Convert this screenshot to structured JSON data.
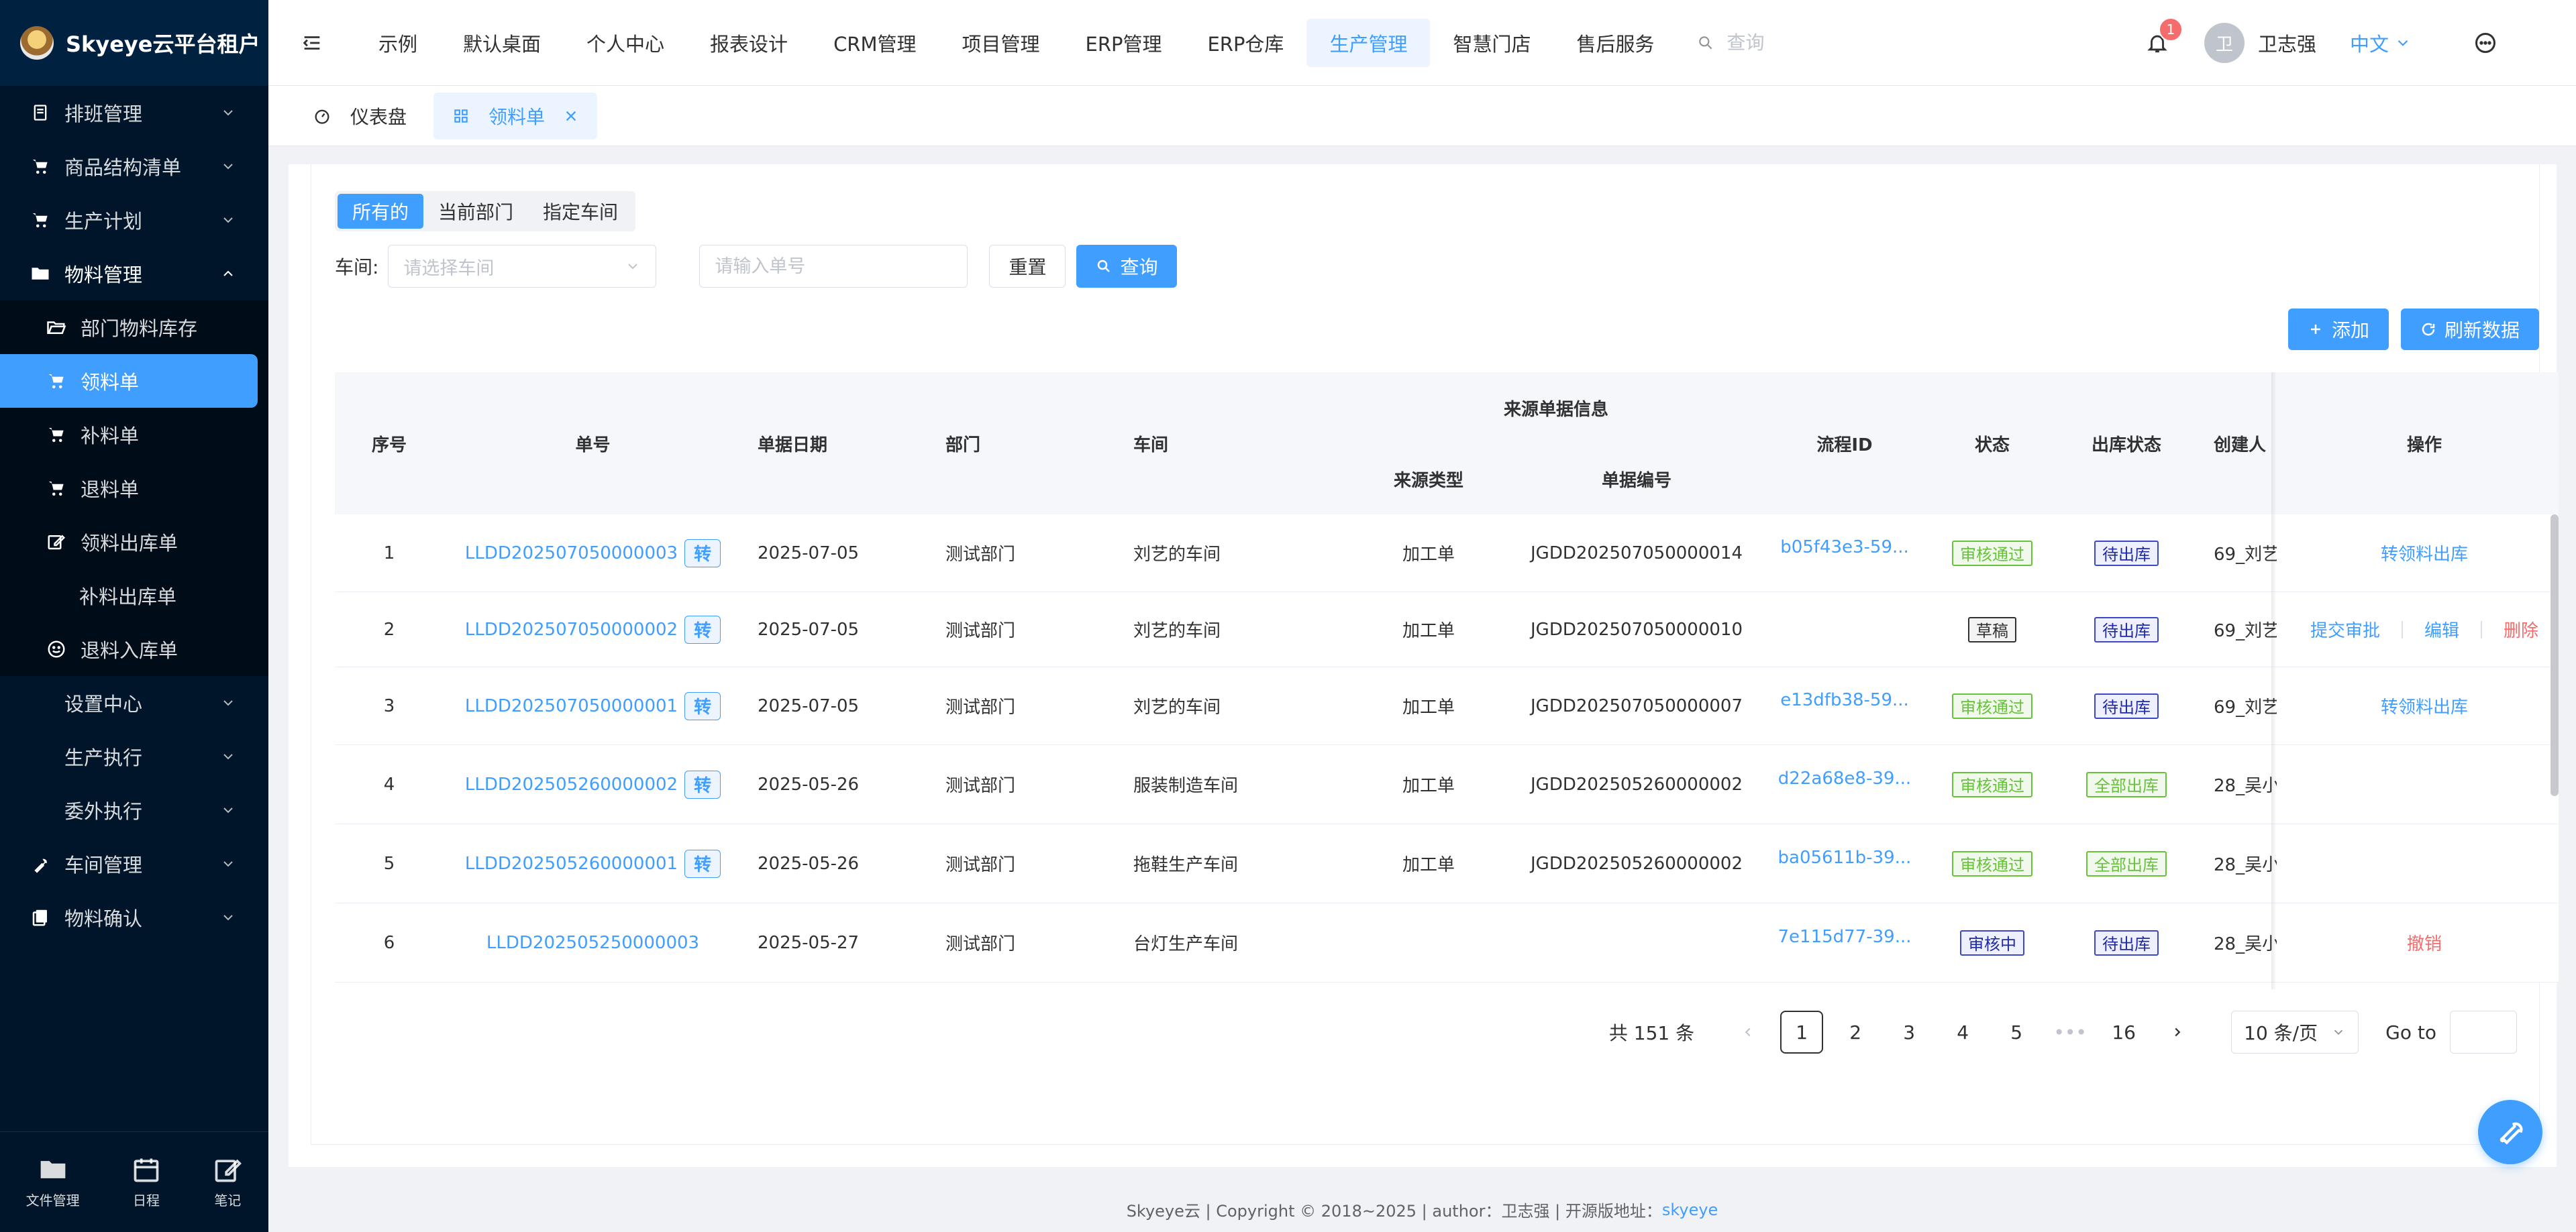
{
  "brand": {
    "title": "Skyeye云平台租户"
  },
  "sidebar": {
    "items": [
      {
        "label": "排班管理",
        "icon": "schedule-icon"
      },
      {
        "label": "商品结构清单",
        "icon": "cart-icon"
      },
      {
        "label": "生产计划",
        "icon": "cart-icon"
      },
      {
        "label": "物料管理",
        "icon": "folder-icon"
      }
    ],
    "material_sub": [
      {
        "label": "部门物料库存",
        "icon": "folder-open-icon"
      },
      {
        "label": "领料单",
        "icon": "cart-icon"
      },
      {
        "label": "补料单",
        "icon": "cart-icon"
      },
      {
        "label": "退料单",
        "icon": "cart-icon"
      },
      {
        "label": "领料出库单",
        "icon": "edit-icon"
      },
      {
        "label": "补料出库单"
      },
      {
        "label": "退料入库单",
        "icon": "smile-icon"
      }
    ],
    "groups": [
      {
        "label": "设置中心"
      },
      {
        "label": "生产执行"
      },
      {
        "label": "委外执行"
      }
    ],
    "bottom_items": [
      {
        "label": "车间管理",
        "icon": "wrench-icon"
      },
      {
        "label": "物料确认",
        "icon": "copy-icon"
      }
    ],
    "footer": {
      "files": "文件管理",
      "calendar": "日程",
      "notes": "笔记"
    }
  },
  "header": {
    "nav": [
      "示例",
      "默认桌面",
      "个人中心",
      "报表设计",
      "CRM管理",
      "项目管理",
      "ERP管理",
      "ERP仓库",
      "生产管理",
      "智慧门店",
      "售后服务"
    ],
    "active_nav": "生产管理",
    "search_placeholder": "查询",
    "notification_count": "1",
    "avatar_text": "卫",
    "username": "卫志强",
    "language": "中文"
  },
  "tabs": [
    {
      "label": "仪表盘"
    },
    {
      "label": "领料单"
    }
  ],
  "filters": {
    "segments": [
      "所有的",
      "当前部门",
      "指定车间"
    ],
    "workshop_label": "车间:",
    "workshop_placeholder": "请选择车间",
    "order_placeholder": "请输入单号",
    "reset": "重置",
    "query": "查询",
    "add": "添加",
    "refresh": "刷新数据"
  },
  "table": {
    "headers": {
      "index": "序号",
      "order_no": "单号",
      "date": "单据日期",
      "dept": "部门",
      "workshop": "车间",
      "source_group": "来源单据信息",
      "source_type": "来源类型",
      "source_no": "单据编号",
      "flow_id": "流程ID",
      "status": "状态",
      "out_status": "出库状态",
      "creator": "创建人",
      "ops": "操作"
    },
    "zhuan_label": "转",
    "rows": [
      {
        "index": "1",
        "order_no": "LLDD202507050000003",
        "zhuan": true,
        "date": "2025-07-05",
        "dept": "测试部门",
        "workshop": "刘艺的车间",
        "source_type": "加工单",
        "source_no": "JGDD202507050000014",
        "flow_id": "b05f43e3-59...",
        "status": "审核通过",
        "status_kind": "success",
        "out_status": "待出库",
        "out_kind": "pending",
        "creator": "69_刘艺",
        "ops": [
          "转领料出库"
        ]
      },
      {
        "index": "2",
        "order_no": "LLDD202507050000002",
        "zhuan": true,
        "date": "2025-07-05",
        "dept": "测试部门",
        "workshop": "刘艺的车间",
        "source_type": "加工单",
        "source_no": "JGDD202507050000010",
        "flow_id": "",
        "status": "草稿",
        "status_kind": "draft",
        "out_status": "待出库",
        "out_kind": "pending",
        "creator": "69_刘艺",
        "ops": [
          "提交审批",
          "编辑",
          "删除"
        ]
      },
      {
        "index": "3",
        "order_no": "LLDD202507050000001",
        "zhuan": true,
        "date": "2025-07-05",
        "dept": "测试部门",
        "workshop": "刘艺的车间",
        "source_type": "加工单",
        "source_no": "JGDD202507050000007",
        "flow_id": "e13dfb38-59...",
        "status": "审核通过",
        "status_kind": "success",
        "out_status": "待出库",
        "out_kind": "pending",
        "creator": "69_刘艺",
        "ops": [
          "转领料出库"
        ]
      },
      {
        "index": "4",
        "order_no": "LLDD202505260000002",
        "zhuan": true,
        "date": "2025-05-26",
        "dept": "测试部门",
        "workshop": "服装制造车间",
        "source_type": "加工单",
        "source_no": "JGDD202505260000002",
        "flow_id": "d22a68e8-39...",
        "status": "审核通过",
        "status_kind": "success",
        "out_status": "全部出库",
        "out_kind": "success",
        "creator": "28_吴小",
        "ops": []
      },
      {
        "index": "5",
        "order_no": "LLDD202505260000001",
        "zhuan": true,
        "date": "2025-05-26",
        "dept": "测试部门",
        "workshop": "拖鞋生产车间",
        "source_type": "加工单",
        "source_no": "JGDD202505260000002",
        "flow_id": "ba05611b-39...",
        "status": "审核通过",
        "status_kind": "success",
        "out_status": "全部出库",
        "out_kind": "success",
        "creator": "28_吴小",
        "ops": []
      },
      {
        "index": "6",
        "order_no": "LLDD202505250000003",
        "zhuan": false,
        "date": "2025-05-27",
        "dept": "测试部门",
        "workshop": "台灯生产车间",
        "source_type": "",
        "source_no": "",
        "flow_id": "7e115d77-39...",
        "status": "审核中",
        "status_kind": "pending",
        "out_status": "待出库",
        "out_kind": "pending",
        "creator": "28_吴小",
        "ops": [
          "撤销"
        ]
      }
    ]
  },
  "pagination": {
    "total": "共 151 条",
    "pages": [
      "1",
      "2",
      "3",
      "4",
      "5",
      "•••",
      "16"
    ],
    "current": "1",
    "page_size": "10 条/页",
    "goto": "Go to"
  },
  "footer": {
    "text": "Skyeye云 | Copyright © 2018~2025 | author：卫志强 | 开源版地址：",
    "link": "skyeye"
  },
  "colors": {
    "primary": "#409eff",
    "sidebar": "#001529",
    "danger": "#f56c6c",
    "success": "#67c23a"
  }
}
